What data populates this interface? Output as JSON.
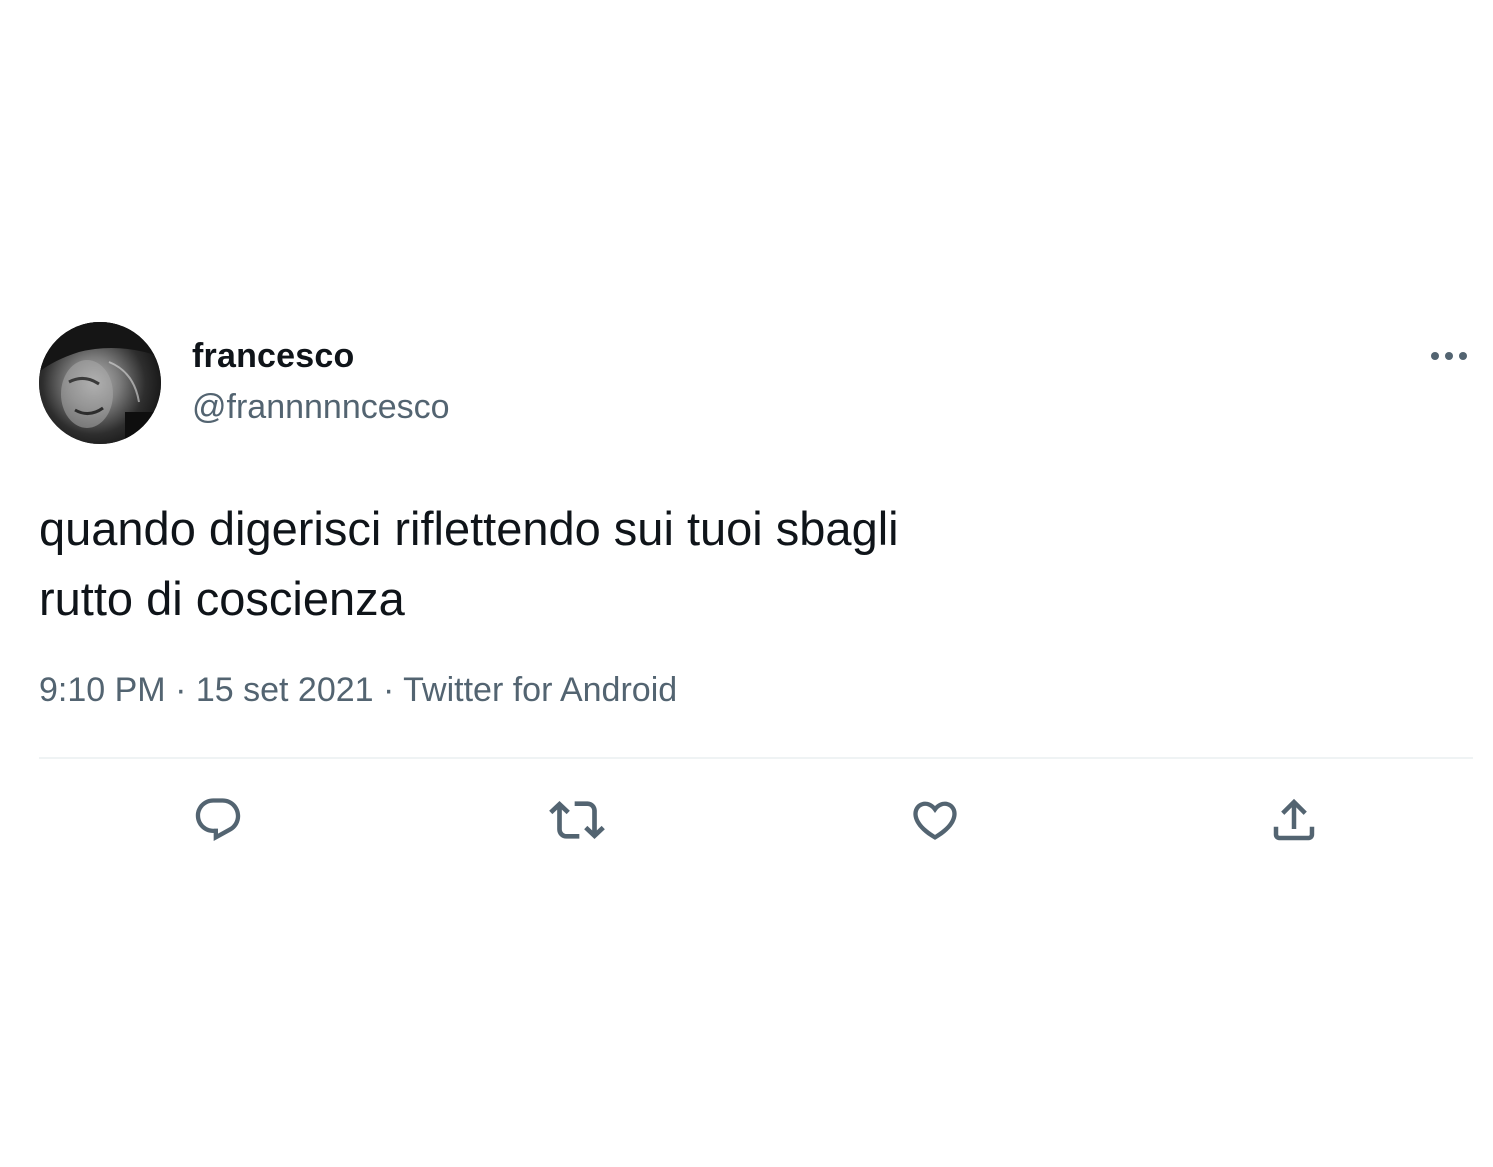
{
  "tweet": {
    "author": {
      "display_name": "francesco",
      "handle": "@frannnnncesco"
    },
    "text_lines": [
      "quando digerisci riflettendo sui tuoi sbagli",
      "rutto di coscienza"
    ],
    "meta": {
      "time": "9:10 PM",
      "separator": " · ",
      "date": "15 set 2021",
      "source": "Twitter for Android"
    }
  },
  "icons": {
    "more": "more-horizontal-icon",
    "reply": "reply-bubble-icon",
    "retweet": "retweet-icon",
    "like": "heart-icon",
    "share": "share-upload-icon"
  },
  "colors": {
    "text_primary": "#0f1419",
    "text_secondary": "#536471",
    "divider": "#eff3f4",
    "background": "#ffffff"
  }
}
